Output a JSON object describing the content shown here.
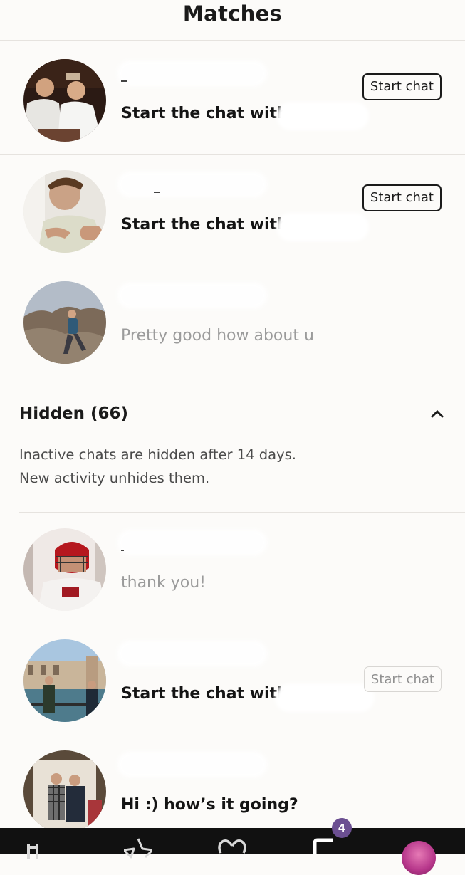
{
  "header": {
    "title": "Matches"
  },
  "rows": [
    {
      "message": "Start the chat with",
      "style": "bold",
      "button": "Start chat",
      "button_style": "active"
    },
    {
      "message": "Start the chat with",
      "style": "bold",
      "button": "Start chat",
      "button_style": "active"
    },
    {
      "message": "Pretty good how about u",
      "style": "faded"
    }
  ],
  "hidden": {
    "title": "Hidden (66)",
    "line1": "Inactive chats are hidden after 14 days.",
    "line2": "New activity unhides them."
  },
  "hidden_rows": [
    {
      "message": "thank you!",
      "style": "faded"
    },
    {
      "message": "Start the chat with",
      "style": "bold",
      "button": "Start chat",
      "button_style": "muted"
    },
    {
      "message": "Hi :) how’s it going?",
      "style": "bold"
    }
  ],
  "tabbar": {
    "tabs": [
      "home-icon",
      "star-icon",
      "heart-icon",
      "chat-icon",
      "profile-avatar"
    ],
    "chat_badge": "4"
  },
  "colors": {
    "background": "#fcfbf9",
    "badge": "#6b4f91",
    "tabbar": "#111111"
  }
}
